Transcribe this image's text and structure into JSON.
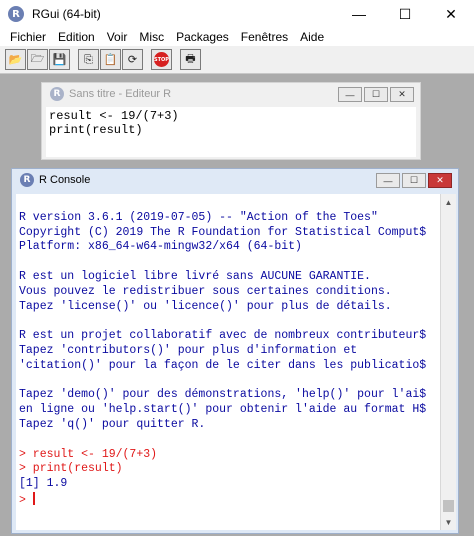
{
  "app": {
    "title": "RGui (64-bit)",
    "minimize": "—",
    "maximize": "☐",
    "close": "✕"
  },
  "menu": [
    "Fichier",
    "Edition",
    "Voir",
    "Misc",
    "Packages",
    "Fenêtres",
    "Aide"
  ],
  "icons": {
    "app": "R",
    "toolbar": [
      "open-folder-icon",
      "load-workspace-icon",
      "save-icon",
      "copy-icon",
      "copy-paste-icon",
      "refresh-icon",
      "stop-icon",
      "print-icon"
    ],
    "toolbar_glyphs": [
      "📂",
      "🗁",
      "💾",
      "⎘",
      "📋",
      "⟳",
      "STOP",
      "🖶"
    ]
  },
  "editor": {
    "title": "Sans titre - Editeur R",
    "lines": [
      "result <- 19/(7+3)",
      "print(result)"
    ]
  },
  "console": {
    "title": "R Console",
    "lines": [
      {
        "text": "",
        "style": "normal"
      },
      {
        "text": "R version 3.6.1 (2019-07-05) -- \"Action of the Toes\"",
        "style": "normal"
      },
      {
        "text": "Copyright (C) 2019 The R Foundation for Statistical Comput$",
        "style": "normal"
      },
      {
        "text": "Platform: x86_64-w64-mingw32/x64 (64-bit)",
        "style": "normal"
      },
      {
        "text": "",
        "style": "normal"
      },
      {
        "text": "R est un logiciel libre livré sans AUCUNE GARANTIE.",
        "style": "normal"
      },
      {
        "text": "Vous pouvez le redistribuer sous certaines conditions.",
        "style": "normal"
      },
      {
        "text": "Tapez 'license()' ou 'licence()' pour plus de détails.",
        "style": "normal"
      },
      {
        "text": "",
        "style": "normal"
      },
      {
        "text": "R est un projet collaboratif avec de nombreux contributeur$",
        "style": "normal"
      },
      {
        "text": "Tapez 'contributors()' pour plus d'information et",
        "style": "normal"
      },
      {
        "text": "'citation()' pour la façon de le citer dans les publicatio$",
        "style": "normal"
      },
      {
        "text": "",
        "style": "normal"
      },
      {
        "text": "Tapez 'demo()' pour des démonstrations, 'help()' pour l'ai$",
        "style": "normal"
      },
      {
        "text": "en ligne ou 'help.start()' pour obtenir l'aide au format H$",
        "style": "normal"
      },
      {
        "text": "Tapez 'q()' pour quitter R.",
        "style": "normal"
      },
      {
        "text": "",
        "style": "normal"
      },
      {
        "text": "> result <- 19/(7+3)",
        "style": "red"
      },
      {
        "text": "> print(result)",
        "style": "red"
      },
      {
        "text": "[1] 1.9",
        "style": "normal"
      },
      {
        "text": "> ",
        "style": "prompt"
      }
    ]
  }
}
